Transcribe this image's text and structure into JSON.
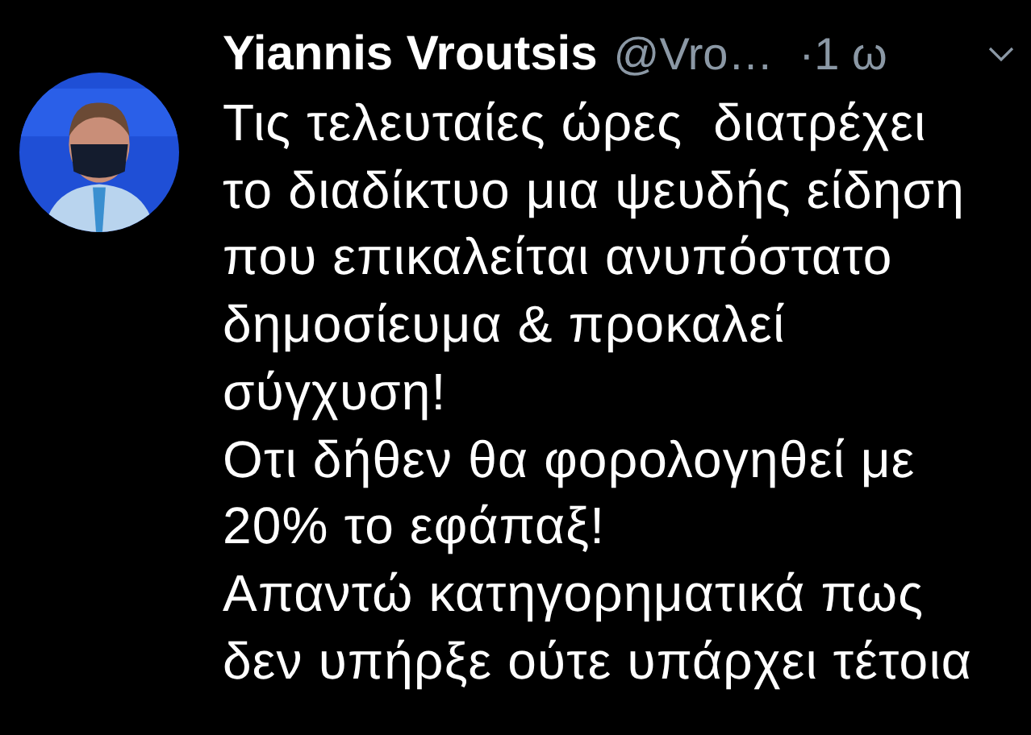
{
  "tweet": {
    "author_name": "Yiannis Vroutsis",
    "handle": "@Vro…",
    "time": "·1 ω",
    "body": "Τις τελευταίες ώρες  διατρέχει\nτο διαδίκτυο μια ψευδής είδηση\nπου επικαλείται ανυπόστατο\nδημοσίευμα & προκαλεί\nσύγχυση!\nΟτι δήθεν θα φορολογηθεί με\n20% το εφάπαξ!\nΑπαντώ κατηγορηματικά πως\nδεν υπήρξε ούτε υπάρχει τέτοια"
  }
}
